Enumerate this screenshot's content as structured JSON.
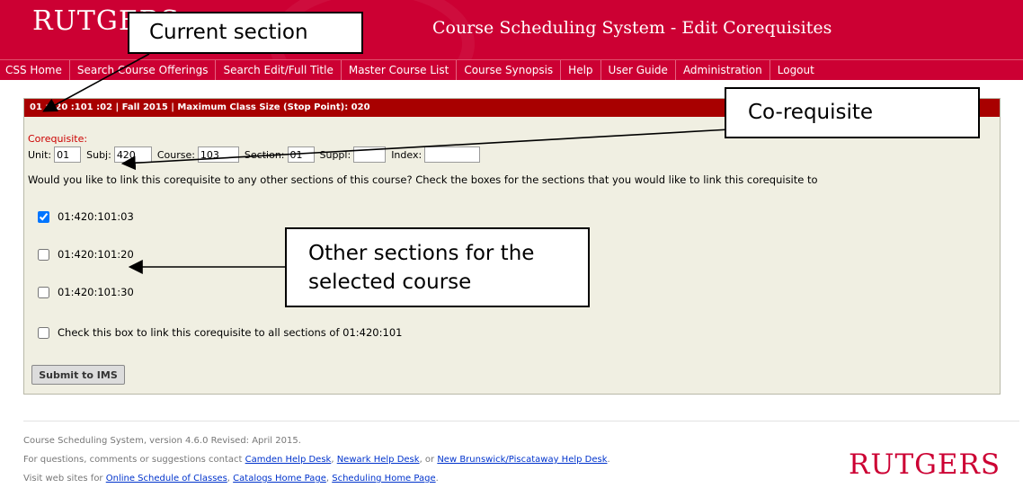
{
  "header": {
    "logo": "RUTGERS",
    "app_title": "Course Scheduling System - Edit Corequisites"
  },
  "nav": {
    "items": [
      {
        "label": "CSS Home"
      },
      {
        "label": "Search Course Offerings"
      },
      {
        "label": "Search Edit/Full Title"
      },
      {
        "label": "Master Course List"
      },
      {
        "label": "Course Synopsis"
      },
      {
        "label": "Help"
      },
      {
        "label": "User Guide"
      },
      {
        "label": "Administration"
      },
      {
        "label": "Logout"
      }
    ]
  },
  "panel": {
    "header": "01 :420 :101 :02 | Fall 2015 | Maximum Class Size (Stop Point): 020",
    "corequisite_label": "Corequisite:",
    "fields": {
      "unit_label": "Unit:",
      "unit_value": "01",
      "subj_label": "Subj:",
      "subj_value": "420",
      "course_label": "Course:",
      "course_value": "103",
      "section_label": "Section:",
      "section_value": "01",
      "suppl_label": "Suppl:",
      "suppl_value": "",
      "index_label": "Index:",
      "index_value": ""
    },
    "question": "Would you like to link this corequisite to any other sections of this course? Check the boxes for the sections that you would like to link this corequisite to",
    "sections": [
      {
        "label": "01:420:101:03",
        "checked": true
      },
      {
        "label": "01:420:101:20",
        "checked": false
      },
      {
        "label": "01:420:101:30",
        "checked": false
      }
    ],
    "all_sections_label": "Check this box to link this corequisite to all sections of 01:420:101",
    "submit_label": "Submit to IMS"
  },
  "footer": {
    "version": "Course Scheduling System, version 4.6.0 Revised: April 2015.",
    "contact_prefix": "For questions, comments or suggestions contact ",
    "camden_link": "Camden Help Desk",
    "sep1": ", ",
    "newark_link": "Newark Help Desk",
    "sep2": ", or ",
    "nb_link": "New Brunswick/Piscataway Help Desk",
    "contact_suffix": ".",
    "visit_prefix": "Visit web sites for ",
    "soc_link": "Online Schedule of Classes",
    "sep3": ", ",
    "catalogs_link": "Catalogs Home Page",
    "sep4": ", ",
    "scheduling_link": "Scheduling Home Page",
    "visit_suffix": ".",
    "logo": "RUTGERS"
  },
  "callouts": {
    "current_section": "Current section",
    "corequisite": "Co-requisite",
    "other_sections_line1": "Other sections for the",
    "other_sections_line2": "selected course"
  },
  "colors": {
    "brand_red": "#cc0033",
    "panel_header_red": "#a80000",
    "panel_bg": "#f0efe2",
    "link_blue": "#0033cc"
  }
}
